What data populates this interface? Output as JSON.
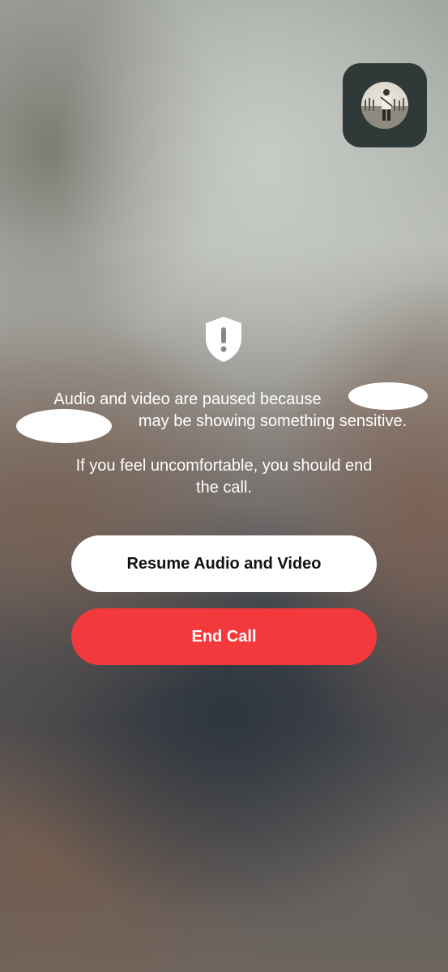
{
  "notice": {
    "line1_prefix": "Audio and video are paused because",
    "line2_suffix": "may be showing something sensitive.",
    "advice": "If you feel uncomfortable, you should end the call."
  },
  "buttons": {
    "resume_label": "Resume Audio and Video",
    "end_label": "End Call"
  },
  "icons": {
    "warning": "shield-exclamation-icon",
    "pip": "self-view-avatar"
  },
  "colors": {
    "end_button": "#f23a3c",
    "resume_button": "#ffffff"
  }
}
